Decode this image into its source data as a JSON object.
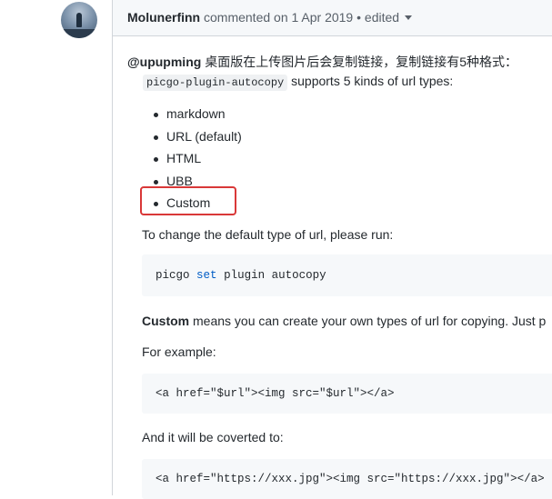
{
  "comment": {
    "author": "Molunerfinn",
    "action": "commented on 1 Apr 2019",
    "separator": "•",
    "edited": "edited",
    "mention": "@upupming",
    "chinese_text": "桌面版在上传图片后会复制链接，复制链接有5种格式：",
    "plugin_name": "picgo-plugin-autocopy",
    "supports_text": "supports 5 kinds of url types:",
    "url_types": [
      "markdown",
      "URL (default)",
      "HTML",
      "UBB",
      "Custom"
    ],
    "change_default_text": "To change the default type of url, please run:",
    "cmd_prefix": "picgo",
    "cmd_keyword": "set",
    "cmd_suffix": "plugin autocopy",
    "custom_bold": "Custom",
    "custom_desc": "means you can create your own types of url for copying. Just p",
    "for_example": "For example:",
    "example_code": "<a href=\"$url\"><img src=\"$url\"></a>",
    "converted_text": "And it will be coverted to:",
    "converted_code": "<a href=\"https://xxx.jpg\"><img src=\"https://xxx.jpg\"></a>"
  },
  "colors": {
    "highlight_border": "#d93838",
    "keyword_blue": "#005cc5",
    "header_bg": "#f6f8fa"
  }
}
